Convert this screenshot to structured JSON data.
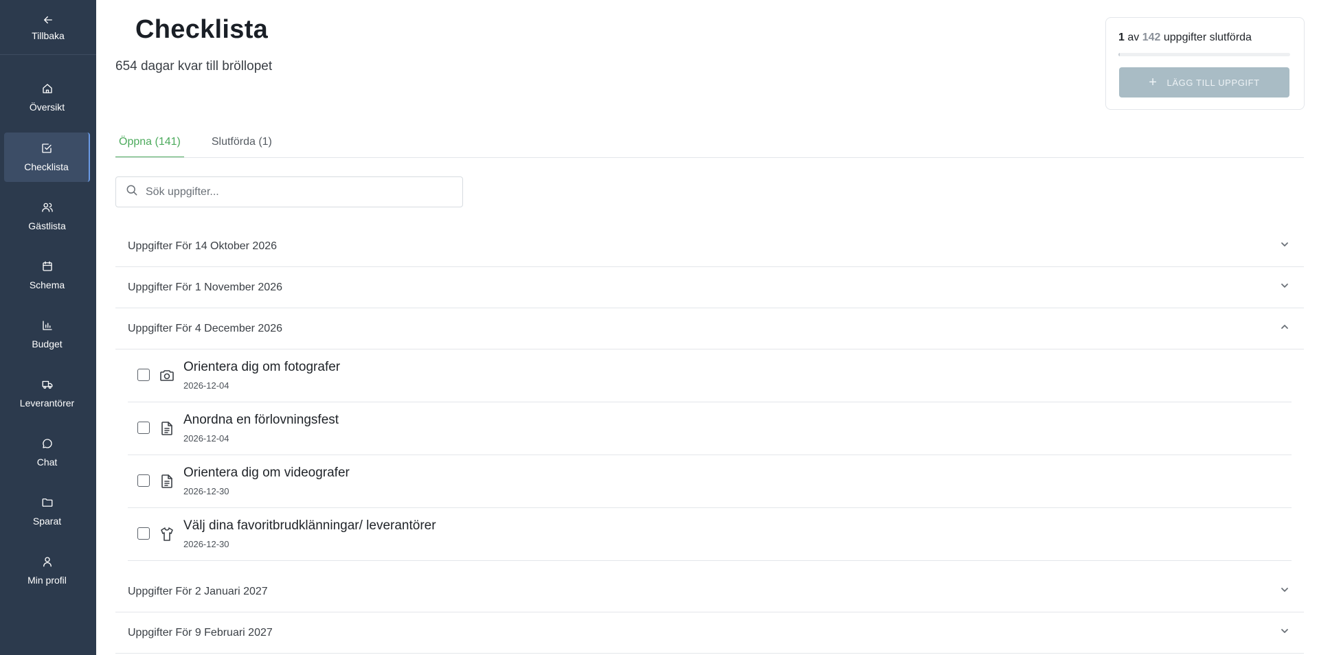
{
  "sidebar": {
    "back_label": "Tillbaka",
    "items": [
      {
        "label": "Översikt",
        "icon": "home-icon"
      },
      {
        "label": "Checklista",
        "icon": "checkbox-icon"
      },
      {
        "label": "Gästlista",
        "icon": "users-icon"
      },
      {
        "label": "Schema",
        "icon": "calendar-icon"
      },
      {
        "label": "Budget",
        "icon": "bar-chart-icon"
      },
      {
        "label": "Leverantörer",
        "icon": "truck-icon"
      },
      {
        "label": "Chat",
        "icon": "chat-bubble-icon"
      },
      {
        "label": "Sparat",
        "icon": "folder-icon"
      },
      {
        "label": "Min profil",
        "icon": "user-icon"
      }
    ],
    "active_item": "Checklista"
  },
  "header": {
    "title": "Checklista",
    "subtitle": "654 dagar kvar till bröllopet"
  },
  "progress": {
    "done": "1",
    "of": "av",
    "total": "142",
    "suffix": "uppgifter slutförda",
    "fraction": 0.007,
    "add_button": "LÄGG TILL UPPGIFT"
  },
  "tabs": [
    {
      "label": "Öppna (141)",
      "active": true
    },
    {
      "label": "Slutförda (1)",
      "active": false
    }
  ],
  "search": {
    "placeholder": "Sök uppgifter..."
  },
  "groups": [
    {
      "title": "Uppgifter För 14 Oktober 2026",
      "expanded": false
    },
    {
      "title": "Uppgifter För 1 November 2026",
      "expanded": false
    },
    {
      "title": "Uppgifter För 4 December 2026",
      "expanded": true,
      "tasks": [
        {
          "title": "Orientera dig om fotografer",
          "date": "2026-12-04",
          "icon": "camera-icon"
        },
        {
          "title": "Anordna en förlovningsfest",
          "date": "2026-12-04",
          "icon": "document-icon"
        },
        {
          "title": "Orientera dig om videografer",
          "date": "2026-12-30",
          "icon": "document-icon"
        },
        {
          "title": "Välj dina favoritbrudklänningar/ leverantörer",
          "date": "2026-12-30",
          "icon": "shirt-icon"
        }
      ]
    },
    {
      "title": "Uppgifter För 2 Januari 2027",
      "expanded": false
    },
    {
      "title": "Uppgifter För 9 Februari 2027",
      "expanded": false
    }
  ]
}
